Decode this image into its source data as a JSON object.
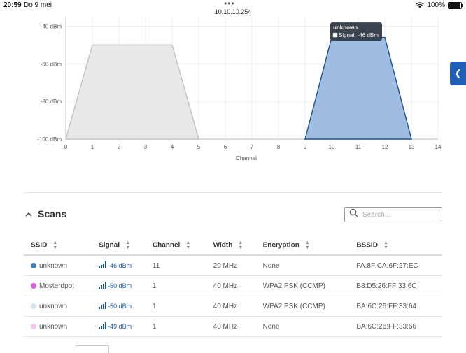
{
  "status": {
    "time": "20:59",
    "date": "Do 9 mei",
    "url": "10.10.10.254",
    "battery": "100%",
    "wifi_icon": "wifi-icon",
    "battery_icon": "battery-icon"
  },
  "side_tab": {
    "icon": "chevron-left-icon",
    "glyph": "❮"
  },
  "chart_data": {
    "type": "area",
    "title": "",
    "xlabel": "Channel",
    "ylabel": "",
    "xlim": [
      0,
      14
    ],
    "ylim": [
      -100,
      -35
    ],
    "xticks": [
      "0",
      "1",
      "2",
      "3",
      "4",
      "5",
      "6",
      "7",
      "8",
      "9",
      "10",
      "11",
      "12",
      "13",
      "14"
    ],
    "yticks": [
      {
        "value": -40,
        "label": "-40 dBm"
      },
      {
        "value": -60,
        "label": "-60 dBm"
      },
      {
        "value": -80,
        "label": "-80 dBm"
      },
      {
        "value": -100,
        "label": "-100 dBm"
      }
    ],
    "grid": true,
    "series": [
      {
        "fill": "#e8e8e8",
        "stroke": "#c2c2c2",
        "points": [
          [
            0,
            -100
          ],
          [
            1,
            -50
          ],
          [
            4,
            -50
          ],
          [
            5,
            -100
          ]
        ]
      },
      {
        "fill": "#9fbde0",
        "stroke": "#1f4f8a",
        "points": [
          [
            9,
            -100
          ],
          [
            10,
            -46
          ],
          [
            12,
            -46
          ],
          [
            13,
            -100
          ]
        ]
      }
    ],
    "tooltip": {
      "title": "unknown",
      "text": "Signal: -46 dBm"
    }
  },
  "scans": {
    "title": "Scans",
    "search_placeholder": "Search...",
    "columns": [
      "SSID",
      "Signal",
      "Channel",
      "Width",
      "Encryption",
      "BSSID"
    ],
    "rows": [
      {
        "ssid": "unknown",
        "color": "#4a7fc1",
        "signal": "-46 dBm",
        "channel": "11",
        "width": "20 MHz",
        "encryption": "None",
        "bssid": "FA:8F:CA:6F:27:EC"
      },
      {
        "ssid": "Mosterdpot",
        "color": "#d85fe0",
        "signal": "-50 dBm",
        "channel": "1",
        "width": "40 MHz",
        "encryption": "WPA2 PSK (CCMP)",
        "bssid": "B8:D5:26:FF:33:6C"
      },
      {
        "ssid": "unknown",
        "color": "#cde8f2",
        "signal": "-50 dBm",
        "channel": "1",
        "width": "40 MHz",
        "encryption": "WPA2 PSK (CCMP)",
        "bssid": "BA:6C:26:FF:33:64"
      },
      {
        "ssid": "unknown",
        "color": "#f5c6f2",
        "signal": "-49 dBm",
        "channel": "1",
        "width": "40 MHz",
        "encryption": "None",
        "bssid": "BA:6C:26:FF:33:66"
      }
    ]
  }
}
